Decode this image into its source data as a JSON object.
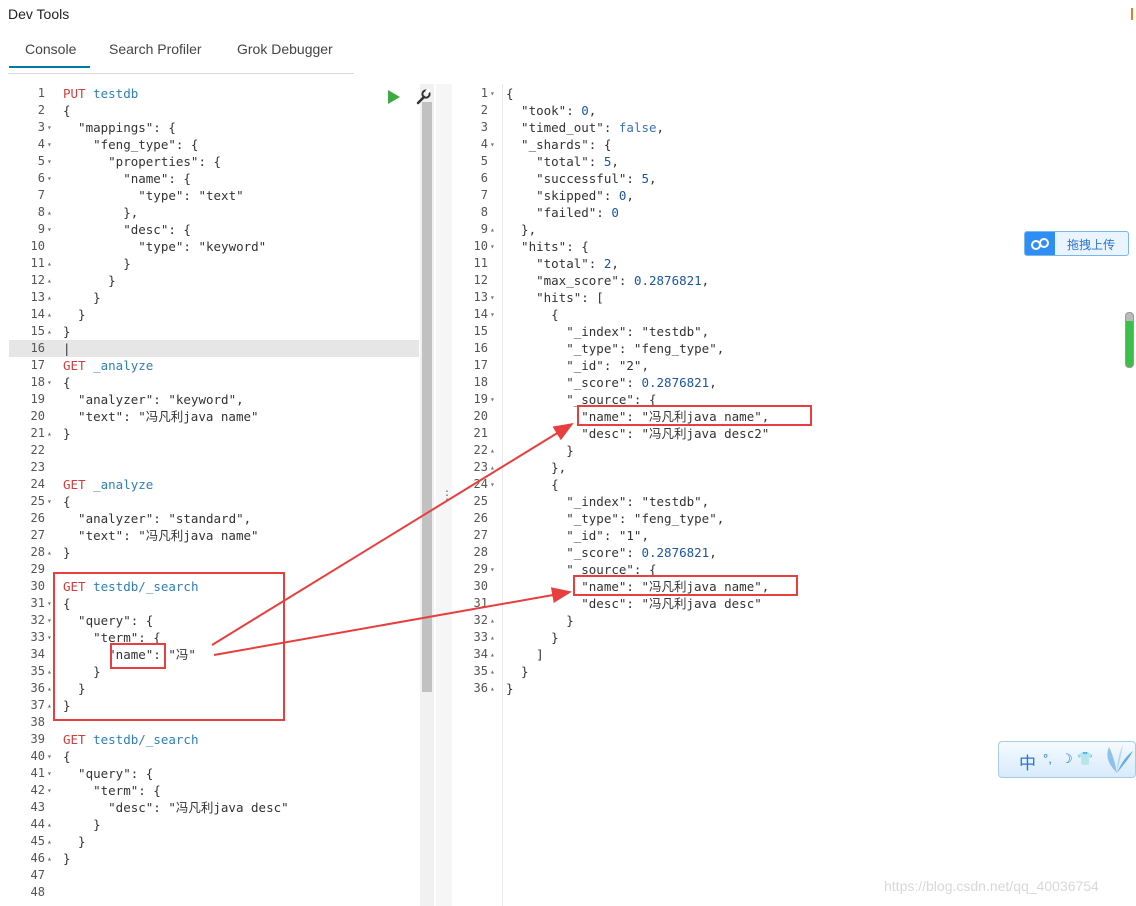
{
  "app_title": "Dev Tools",
  "tabs": [
    "Console",
    "Search Profiler",
    "Grok Debugger"
  ],
  "left_editor": [
    {
      "n": "1",
      "fold": "",
      "t": [
        [
          "k",
          "PUT"
        ],
        [
          "s",
          " "
        ],
        [
          "u",
          "testdb"
        ]
      ]
    },
    {
      "n": "2",
      "fold": "",
      "t": [
        [
          "s",
          "{"
        ]
      ]
    },
    {
      "n": "3",
      "fold": "▾",
      "t": [
        [
          "s",
          "  \"mappings\": {"
        ]
      ]
    },
    {
      "n": "4",
      "fold": "▾",
      "t": [
        [
          "s",
          "    \"feng_type\": {"
        ]
      ]
    },
    {
      "n": "5",
      "fold": "▾",
      "t": [
        [
          "s",
          "      \"properties\": {"
        ]
      ]
    },
    {
      "n": "6",
      "fold": "▾",
      "t": [
        [
          "s",
          "        \"name\": {"
        ]
      ]
    },
    {
      "n": "7",
      "fold": "",
      "t": [
        [
          "s",
          "          \"type\": \"text\""
        ]
      ]
    },
    {
      "n": "8",
      "fold": "▴",
      "t": [
        [
          "s",
          "        },"
        ]
      ]
    },
    {
      "n": "9",
      "fold": "▾",
      "t": [
        [
          "s",
          "        \"desc\": {"
        ]
      ]
    },
    {
      "n": "10",
      "fold": "",
      "t": [
        [
          "s",
          "          \"type\": \"keyword\""
        ]
      ]
    },
    {
      "n": "11",
      "fold": "▴",
      "t": [
        [
          "s",
          "        }"
        ]
      ]
    },
    {
      "n": "12",
      "fold": "▴",
      "t": [
        [
          "s",
          "      }"
        ]
      ]
    },
    {
      "n": "13",
      "fold": "▴",
      "t": [
        [
          "s",
          "    }"
        ]
      ]
    },
    {
      "n": "14",
      "fold": "▴",
      "t": [
        [
          "s",
          "  }"
        ]
      ]
    },
    {
      "n": "15",
      "fold": "▴",
      "t": [
        [
          "s",
          "}"
        ]
      ]
    },
    {
      "n": "16",
      "fold": "",
      "t": [
        [
          "s",
          "|"
        ]
      ],
      "hl": true
    },
    {
      "n": "17",
      "fold": "",
      "t": [
        [
          "k",
          "GET"
        ],
        [
          "s",
          " "
        ],
        [
          "u",
          "_analyze"
        ]
      ]
    },
    {
      "n": "18",
      "fold": "▾",
      "t": [
        [
          "s",
          "{"
        ]
      ]
    },
    {
      "n": "19",
      "fold": "",
      "t": [
        [
          "s",
          "  \"analyzer\": \"keyword\","
        ]
      ]
    },
    {
      "n": "20",
      "fold": "",
      "t": [
        [
          "s",
          "  \"text\": \"冯凡利java name\""
        ]
      ]
    },
    {
      "n": "21",
      "fold": "▴",
      "t": [
        [
          "s",
          "}"
        ]
      ]
    },
    {
      "n": "22",
      "fold": "",
      "t": []
    },
    {
      "n": "23",
      "fold": "",
      "t": []
    },
    {
      "n": "24",
      "fold": "",
      "t": [
        [
          "k",
          "GET"
        ],
        [
          "s",
          " "
        ],
        [
          "u",
          "_analyze"
        ]
      ]
    },
    {
      "n": "25",
      "fold": "▾",
      "t": [
        [
          "s",
          "{"
        ]
      ]
    },
    {
      "n": "26",
      "fold": "",
      "t": [
        [
          "s",
          "  \"analyzer\": \"standard\","
        ]
      ]
    },
    {
      "n": "27",
      "fold": "",
      "t": [
        [
          "s",
          "  \"text\": \"冯凡利java name\""
        ]
      ]
    },
    {
      "n": "28",
      "fold": "▴",
      "t": [
        [
          "s",
          "}"
        ]
      ]
    },
    {
      "n": "29",
      "fold": "",
      "t": []
    },
    {
      "n": "30",
      "fold": "",
      "t": [
        [
          "k",
          "GET"
        ],
        [
          "s",
          " "
        ],
        [
          "u",
          "testdb/_search"
        ]
      ]
    },
    {
      "n": "31",
      "fold": "▾",
      "t": [
        [
          "s",
          "{"
        ]
      ]
    },
    {
      "n": "32",
      "fold": "▾",
      "t": [
        [
          "s",
          "  \"query\": {"
        ]
      ]
    },
    {
      "n": "33",
      "fold": "▾",
      "t": [
        [
          "s",
          "    \"term\": {"
        ]
      ]
    },
    {
      "n": "34",
      "fold": "",
      "t": [
        [
          "s",
          "      \"name\": \"冯\""
        ]
      ]
    },
    {
      "n": "35",
      "fold": "▴",
      "t": [
        [
          "s",
          "    }"
        ]
      ]
    },
    {
      "n": "36",
      "fold": "▴",
      "t": [
        [
          "s",
          "  }"
        ]
      ]
    },
    {
      "n": "37",
      "fold": "▴",
      "t": [
        [
          "s",
          "}"
        ]
      ]
    },
    {
      "n": "38",
      "fold": "",
      "t": []
    },
    {
      "n": "39",
      "fold": "",
      "t": [
        [
          "k",
          "GET"
        ],
        [
          "s",
          " "
        ],
        [
          "u",
          "testdb/_search"
        ]
      ]
    },
    {
      "n": "40",
      "fold": "▾",
      "t": [
        [
          "s",
          "{"
        ]
      ]
    },
    {
      "n": "41",
      "fold": "▾",
      "t": [
        [
          "s",
          "  \"query\": {"
        ]
      ]
    },
    {
      "n": "42",
      "fold": "▾",
      "t": [
        [
          "s",
          "    \"term\": {"
        ]
      ]
    },
    {
      "n": "43",
      "fold": "",
      "t": [
        [
          "s",
          "      \"desc\": \"冯凡利java desc\""
        ]
      ]
    },
    {
      "n": "44",
      "fold": "▴",
      "t": [
        [
          "s",
          "    }"
        ]
      ]
    },
    {
      "n": "45",
      "fold": "▴",
      "t": [
        [
          "s",
          "  }"
        ]
      ]
    },
    {
      "n": "46",
      "fold": "▴",
      "t": [
        [
          "s",
          "}"
        ]
      ]
    },
    {
      "n": "47",
      "fold": "",
      "t": []
    },
    {
      "n": "48",
      "fold": "",
      "t": []
    }
  ],
  "right_output": [
    {
      "n": "1",
      "fold": "▾",
      "t": [
        [
          "s",
          "{"
        ]
      ]
    },
    {
      "n": "2",
      "fold": "",
      "t": [
        [
          "s",
          "  \"took\": "
        ],
        [
          "n",
          "0"
        ],
        [
          "s",
          ","
        ]
      ]
    },
    {
      "n": "3",
      "fold": "",
      "t": [
        [
          "s",
          "  \"timed_out\": "
        ],
        [
          "b",
          "false"
        ],
        [
          "s",
          ","
        ]
      ]
    },
    {
      "n": "4",
      "fold": "▾",
      "t": [
        [
          "s",
          "  \"_shards\": {"
        ]
      ]
    },
    {
      "n": "5",
      "fold": "",
      "t": [
        [
          "s",
          "    \"total\": "
        ],
        [
          "n",
          "5"
        ],
        [
          "s",
          ","
        ]
      ]
    },
    {
      "n": "6",
      "fold": "",
      "t": [
        [
          "s",
          "    \"successful\": "
        ],
        [
          "n",
          "5"
        ],
        [
          "s",
          ","
        ]
      ]
    },
    {
      "n": "7",
      "fold": "",
      "t": [
        [
          "s",
          "    \"skipped\": "
        ],
        [
          "n",
          "0"
        ],
        [
          "s",
          ","
        ]
      ]
    },
    {
      "n": "8",
      "fold": "",
      "t": [
        [
          "s",
          "    \"failed\": "
        ],
        [
          "n",
          "0"
        ]
      ]
    },
    {
      "n": "9",
      "fold": "▴",
      "t": [
        [
          "s",
          "  },"
        ]
      ]
    },
    {
      "n": "10",
      "fold": "▾",
      "t": [
        [
          "s",
          "  \"hits\": {"
        ]
      ]
    },
    {
      "n": "11",
      "fold": "",
      "t": [
        [
          "s",
          "    \"total\": "
        ],
        [
          "n",
          "2"
        ],
        [
          "s",
          ","
        ]
      ]
    },
    {
      "n": "12",
      "fold": "",
      "t": [
        [
          "s",
          "    \"max_score\": "
        ],
        [
          "n",
          "0.2876821"
        ],
        [
          "s",
          ","
        ]
      ]
    },
    {
      "n": "13",
      "fold": "▾",
      "t": [
        [
          "s",
          "    \"hits\": ["
        ]
      ]
    },
    {
      "n": "14",
      "fold": "▾",
      "t": [
        [
          "s",
          "      {"
        ]
      ]
    },
    {
      "n": "15",
      "fold": "",
      "t": [
        [
          "s",
          "        \"_index\": \"testdb\","
        ]
      ]
    },
    {
      "n": "16",
      "fold": "",
      "t": [
        [
          "s",
          "        \"_type\": \"feng_type\","
        ]
      ]
    },
    {
      "n": "17",
      "fold": "",
      "t": [
        [
          "s",
          "        \"_id\": \"2\","
        ]
      ]
    },
    {
      "n": "18",
      "fold": "",
      "t": [
        [
          "s",
          "        \"_score\": "
        ],
        [
          "n",
          "0.2876821"
        ],
        [
          "s",
          ","
        ]
      ]
    },
    {
      "n": "19",
      "fold": "▾",
      "t": [
        [
          "s",
          "        \"_source\": {"
        ]
      ]
    },
    {
      "n": "20",
      "fold": "",
      "t": [
        [
          "s",
          "          \"name\": \"冯凡利java name\","
        ]
      ]
    },
    {
      "n": "21",
      "fold": "",
      "t": [
        [
          "s",
          "          \"desc\": \"冯凡利java desc2\""
        ]
      ]
    },
    {
      "n": "22",
      "fold": "▴",
      "t": [
        [
          "s",
          "        }"
        ]
      ]
    },
    {
      "n": "23",
      "fold": "▴",
      "t": [
        [
          "s",
          "      },"
        ]
      ]
    },
    {
      "n": "24",
      "fold": "▾",
      "t": [
        [
          "s",
          "      {"
        ]
      ]
    },
    {
      "n": "25",
      "fold": "",
      "t": [
        [
          "s",
          "        \"_index\": \"testdb\","
        ]
      ]
    },
    {
      "n": "26",
      "fold": "",
      "t": [
        [
          "s",
          "        \"_type\": \"feng_type\","
        ]
      ]
    },
    {
      "n": "27",
      "fold": "",
      "t": [
        [
          "s",
          "        \"_id\": \"1\","
        ]
      ]
    },
    {
      "n": "28",
      "fold": "",
      "t": [
        [
          "s",
          "        \"_score\": "
        ],
        [
          "n",
          "0.2876821"
        ],
        [
          "s",
          ","
        ]
      ]
    },
    {
      "n": "29",
      "fold": "▾",
      "t": [
        [
          "s",
          "        \"_source\": {"
        ]
      ]
    },
    {
      "n": "30",
      "fold": "",
      "t": [
        [
          "s",
          "          \"name\": \"冯凡利java name\","
        ]
      ]
    },
    {
      "n": "31",
      "fold": "",
      "t": [
        [
          "s",
          "          \"desc\": \"冯凡利java desc\""
        ]
      ]
    },
    {
      "n": "32",
      "fold": "▴",
      "t": [
        [
          "s",
          "        }"
        ]
      ]
    },
    {
      "n": "33",
      "fold": "▴",
      "t": [
        [
          "s",
          "      }"
        ]
      ]
    },
    {
      "n": "34",
      "fold": "▴",
      "t": [
        [
          "s",
          "    ]"
        ]
      ]
    },
    {
      "n": "35",
      "fold": "▴",
      "t": [
        [
          "s",
          "  }"
        ]
      ]
    },
    {
      "n": "36",
      "fold": "▴",
      "t": [
        [
          "s",
          "}"
        ]
      ]
    }
  ],
  "upload_label": "拖拽上传",
  "ime": {
    "lang": "中",
    "symbols": [
      "°,",
      "☽",
      "👕"
    ]
  },
  "watermark": "https://blog.csdn.net/qq_40036754",
  "colors": {
    "accent": "#0079a5",
    "annotation": "#e83e3e",
    "run": "#3eaa43"
  }
}
